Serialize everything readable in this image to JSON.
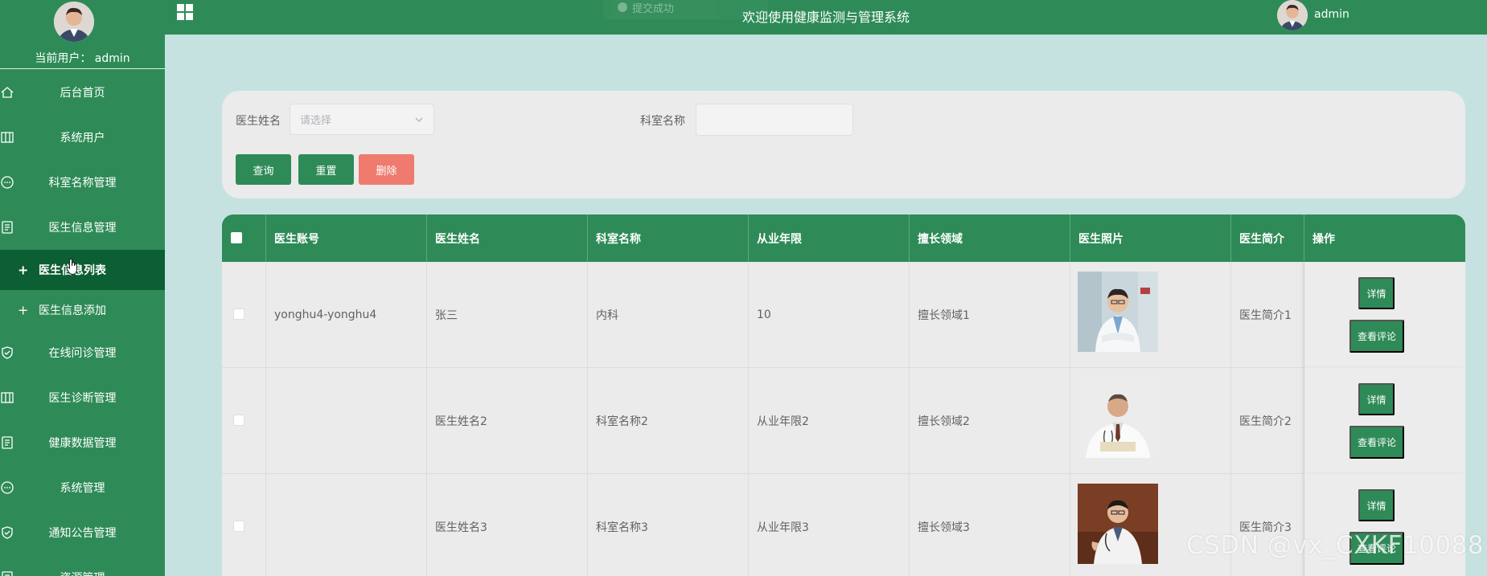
{
  "sidebar": {
    "current_user": "当前用户： admin",
    "items": [
      {
        "label": "后台首页",
        "icon": "home-icon"
      },
      {
        "label": "系统用户",
        "icon": "columns-icon"
      },
      {
        "label": "科室名称管理",
        "icon": "chat-icon"
      },
      {
        "label": "医生信息管理",
        "icon": "document-icon"
      }
    ],
    "sub_items": [
      {
        "label": "医生信息列表",
        "active": true
      },
      {
        "label": "医生信息添加",
        "active": false
      }
    ],
    "items_after": [
      {
        "label": "在线问诊管理",
        "icon": "shield-check-icon"
      },
      {
        "label": "医生诊断管理",
        "icon": "columns-icon"
      },
      {
        "label": "健康数据管理",
        "icon": "document-icon"
      },
      {
        "label": "系统管理",
        "icon": "chat-icon"
      },
      {
        "label": "通知公告管理",
        "icon": "shield-check-icon"
      },
      {
        "label": "资源管理",
        "icon": "document-icon"
      }
    ]
  },
  "header": {
    "title": "欢迎使用健康监测与管理系统",
    "username": "admin",
    "toast": "提交成功"
  },
  "search": {
    "doctor_name_label": "医生姓名",
    "doctor_name_placeholder": "请选择",
    "dept_label": "科室名称",
    "query_btn": "查询",
    "reset_btn": "重置",
    "delete_btn": "删除"
  },
  "table": {
    "columns": [
      "医生账号",
      "医生姓名",
      "科室名称",
      "从业年限",
      "擅长领域",
      "医生照片",
      "医生简介",
      "操作"
    ],
    "rows": [
      {
        "account": "yonghu4-yonghu4",
        "name": "张三",
        "dept": "内科",
        "years": "10",
        "field": "擅长领域1",
        "intro": "医生简介1"
      },
      {
        "account": "",
        "name": "医生姓名2",
        "dept": "科室名称2",
        "years": "从业年限2",
        "field": "擅长领域2",
        "intro": "医生简介2"
      },
      {
        "account": "",
        "name": "医生姓名3",
        "dept": "科室名称3",
        "years": "从业年限3",
        "field": "擅长领域3",
        "intro": "医生简介3"
      }
    ],
    "detail_btn": "详情",
    "comment_btn": "查看评论"
  },
  "watermark": "CSDN @vx_CXKF10088",
  "colors": {
    "primary": "#2e8b57",
    "active_menu": "#0c5e33",
    "danger": "#ee7b6e",
    "background": "#c5e2e1"
  }
}
